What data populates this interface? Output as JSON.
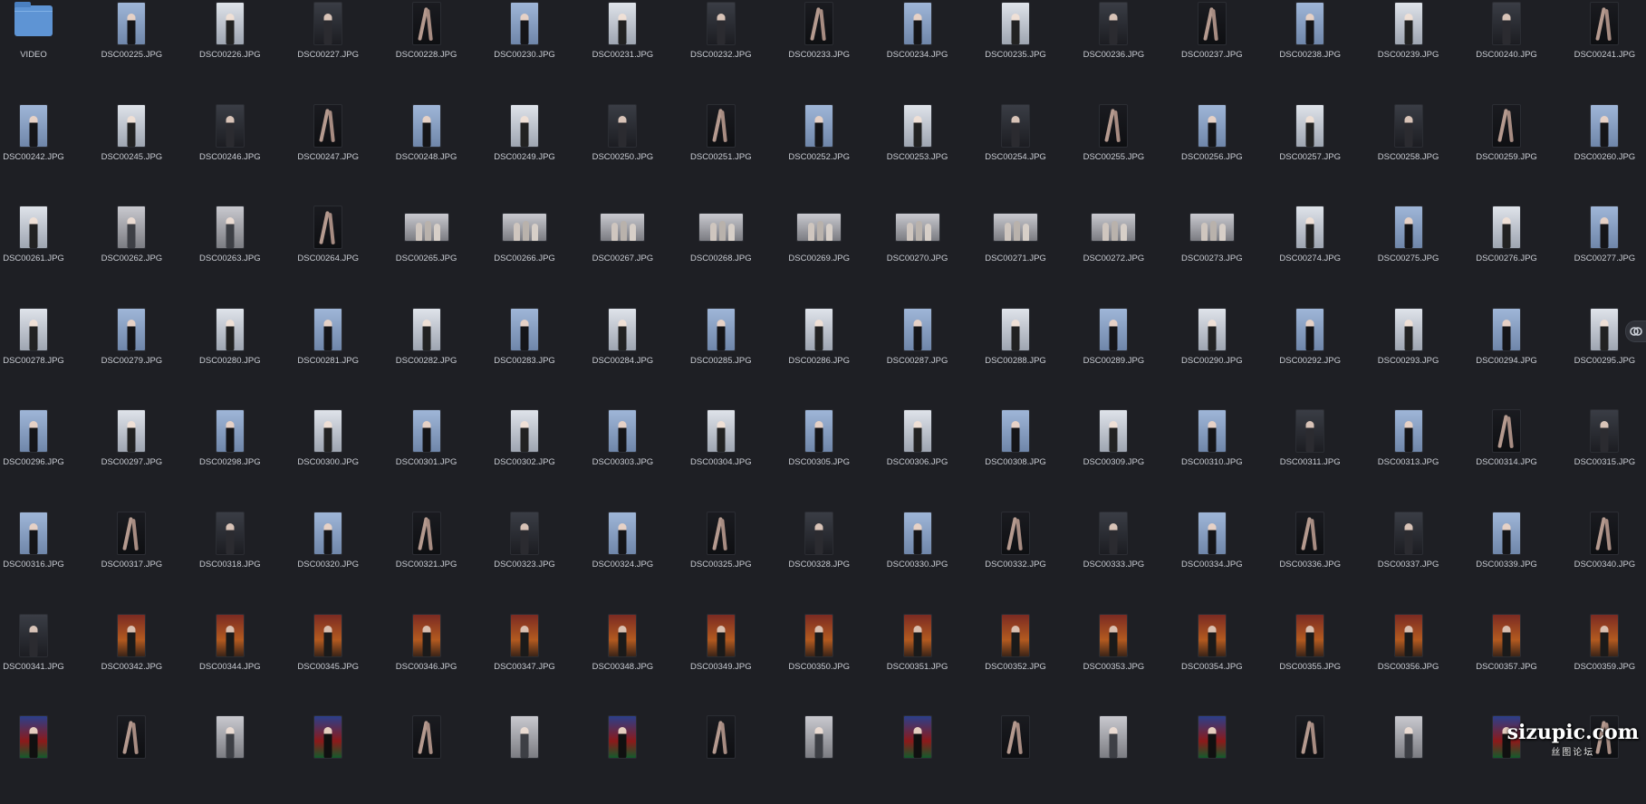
{
  "folder": {
    "name": "VIDEO",
    "icon": "folder-icon"
  },
  "files": [
    "DSC00225.JPG",
    "DSC00226.JPG",
    "DSC00227.JPG",
    "DSC00228.JPG",
    "DSC00230.JPG",
    "DSC00231.JPG",
    "DSC00232.JPG",
    "DSC00233.JPG",
    "DSC00234.JPG",
    "DSC00235.JPG",
    "DSC00236.JPG",
    "DSC00237.JPG",
    "DSC00238.JPG",
    "DSC00239.JPG",
    "DSC00240.JPG",
    "DSC00241.JPG",
    "DSC00242.JPG",
    "DSC00245.JPG",
    "DSC00246.JPG",
    "DSC00247.JPG",
    "DSC00248.JPG",
    "DSC00249.JPG",
    "DSC00250.JPG",
    "DSC00251.JPG",
    "DSC00252.JPG",
    "DSC00253.JPG",
    "DSC00254.JPG",
    "DSC00255.JPG",
    "DSC00256.JPG",
    "DSC00257.JPG",
    "DSC00258.JPG",
    "DSC00259.JPG",
    "DSC00260.JPG",
    "DSC00261.JPG",
    "DSC00262.JPG",
    "DSC00263.JPG",
    "DSC00264.JPG",
    "DSC00265.JPG",
    "DSC00266.JPG",
    "DSC00267.JPG",
    "DSC00268.JPG",
    "DSC00269.JPG",
    "DSC00270.JPG",
    "DSC00271.JPG",
    "DSC00272.JPG",
    "DSC00273.JPG",
    "DSC00274.JPG",
    "DSC00275.JPG",
    "DSC00276.JPG",
    "DSC00277.JPG",
    "DSC00278.JPG",
    "DSC00279.JPG",
    "DSC00280.JPG",
    "DSC00281.JPG",
    "DSC00282.JPG",
    "DSC00283.JPG",
    "DSC00284.JPG",
    "DSC00285.JPG",
    "DSC00286.JPG",
    "DSC00287.JPG",
    "DSC00288.JPG",
    "DSC00289.JPG",
    "DSC00290.JPG",
    "DSC00292.JPG",
    "DSC00293.JPG",
    "DSC00294.JPG",
    "DSC00295.JPG",
    "DSC00296.JPG",
    "DSC00297.JPG",
    "DSC00298.JPG",
    "DSC00300.JPG",
    "DSC00301.JPG",
    "DSC00302.JPG",
    "DSC00303.JPG",
    "DSC00304.JPG",
    "DSC00305.JPG",
    "DSC00306.JPG",
    "DSC00308.JPG",
    "DSC00309.JPG",
    "DSC00310.JPG",
    "DSC00311.JPG",
    "DSC00313.JPG",
    "DSC00314.JPG",
    "DSC00315.JPG",
    "DSC00316.JPG",
    "DSC00317.JPG",
    "DSC00318.JPG",
    "DSC00320.JPG",
    "DSC00321.JPG",
    "DSC00323.JPG",
    "DSC00324.JPG",
    "DSC00325.JPG",
    "DSC00328.JPG",
    "DSC00330.JPG",
    "DSC00332.JPG",
    "DSC00333.JPG",
    "DSC00334.JPG",
    "DSC00336.JPG",
    "DSC00337.JPG",
    "DSC00339.JPG",
    "DSC00340.JPG",
    "DSC00341.JPG",
    "DSC00342.JPG",
    "DSC00344.JPG",
    "DSC00345.JPG",
    "DSC00346.JPG",
    "DSC00347.JPG",
    "DSC00348.JPG",
    "DSC00349.JPG",
    "DSC00350.JPG",
    "DSC00351.JPG",
    "DSC00352.JPG",
    "DSC00353.JPG",
    "DSC00354.JPG",
    "DSC00355.JPG",
    "DSC00356.JPG",
    "DSC00357.JPG",
    "DSC00359.JPG"
  ],
  "last_row_thumbs": 17,
  "watermark": {
    "main": "sizupic.com",
    "sub": "丝图论坛"
  },
  "side_icon": "link-icon",
  "colors": {
    "background": "#1e1f24",
    "label_text": "#c9ccd3",
    "folder_blue": "#5e94d4"
  }
}
